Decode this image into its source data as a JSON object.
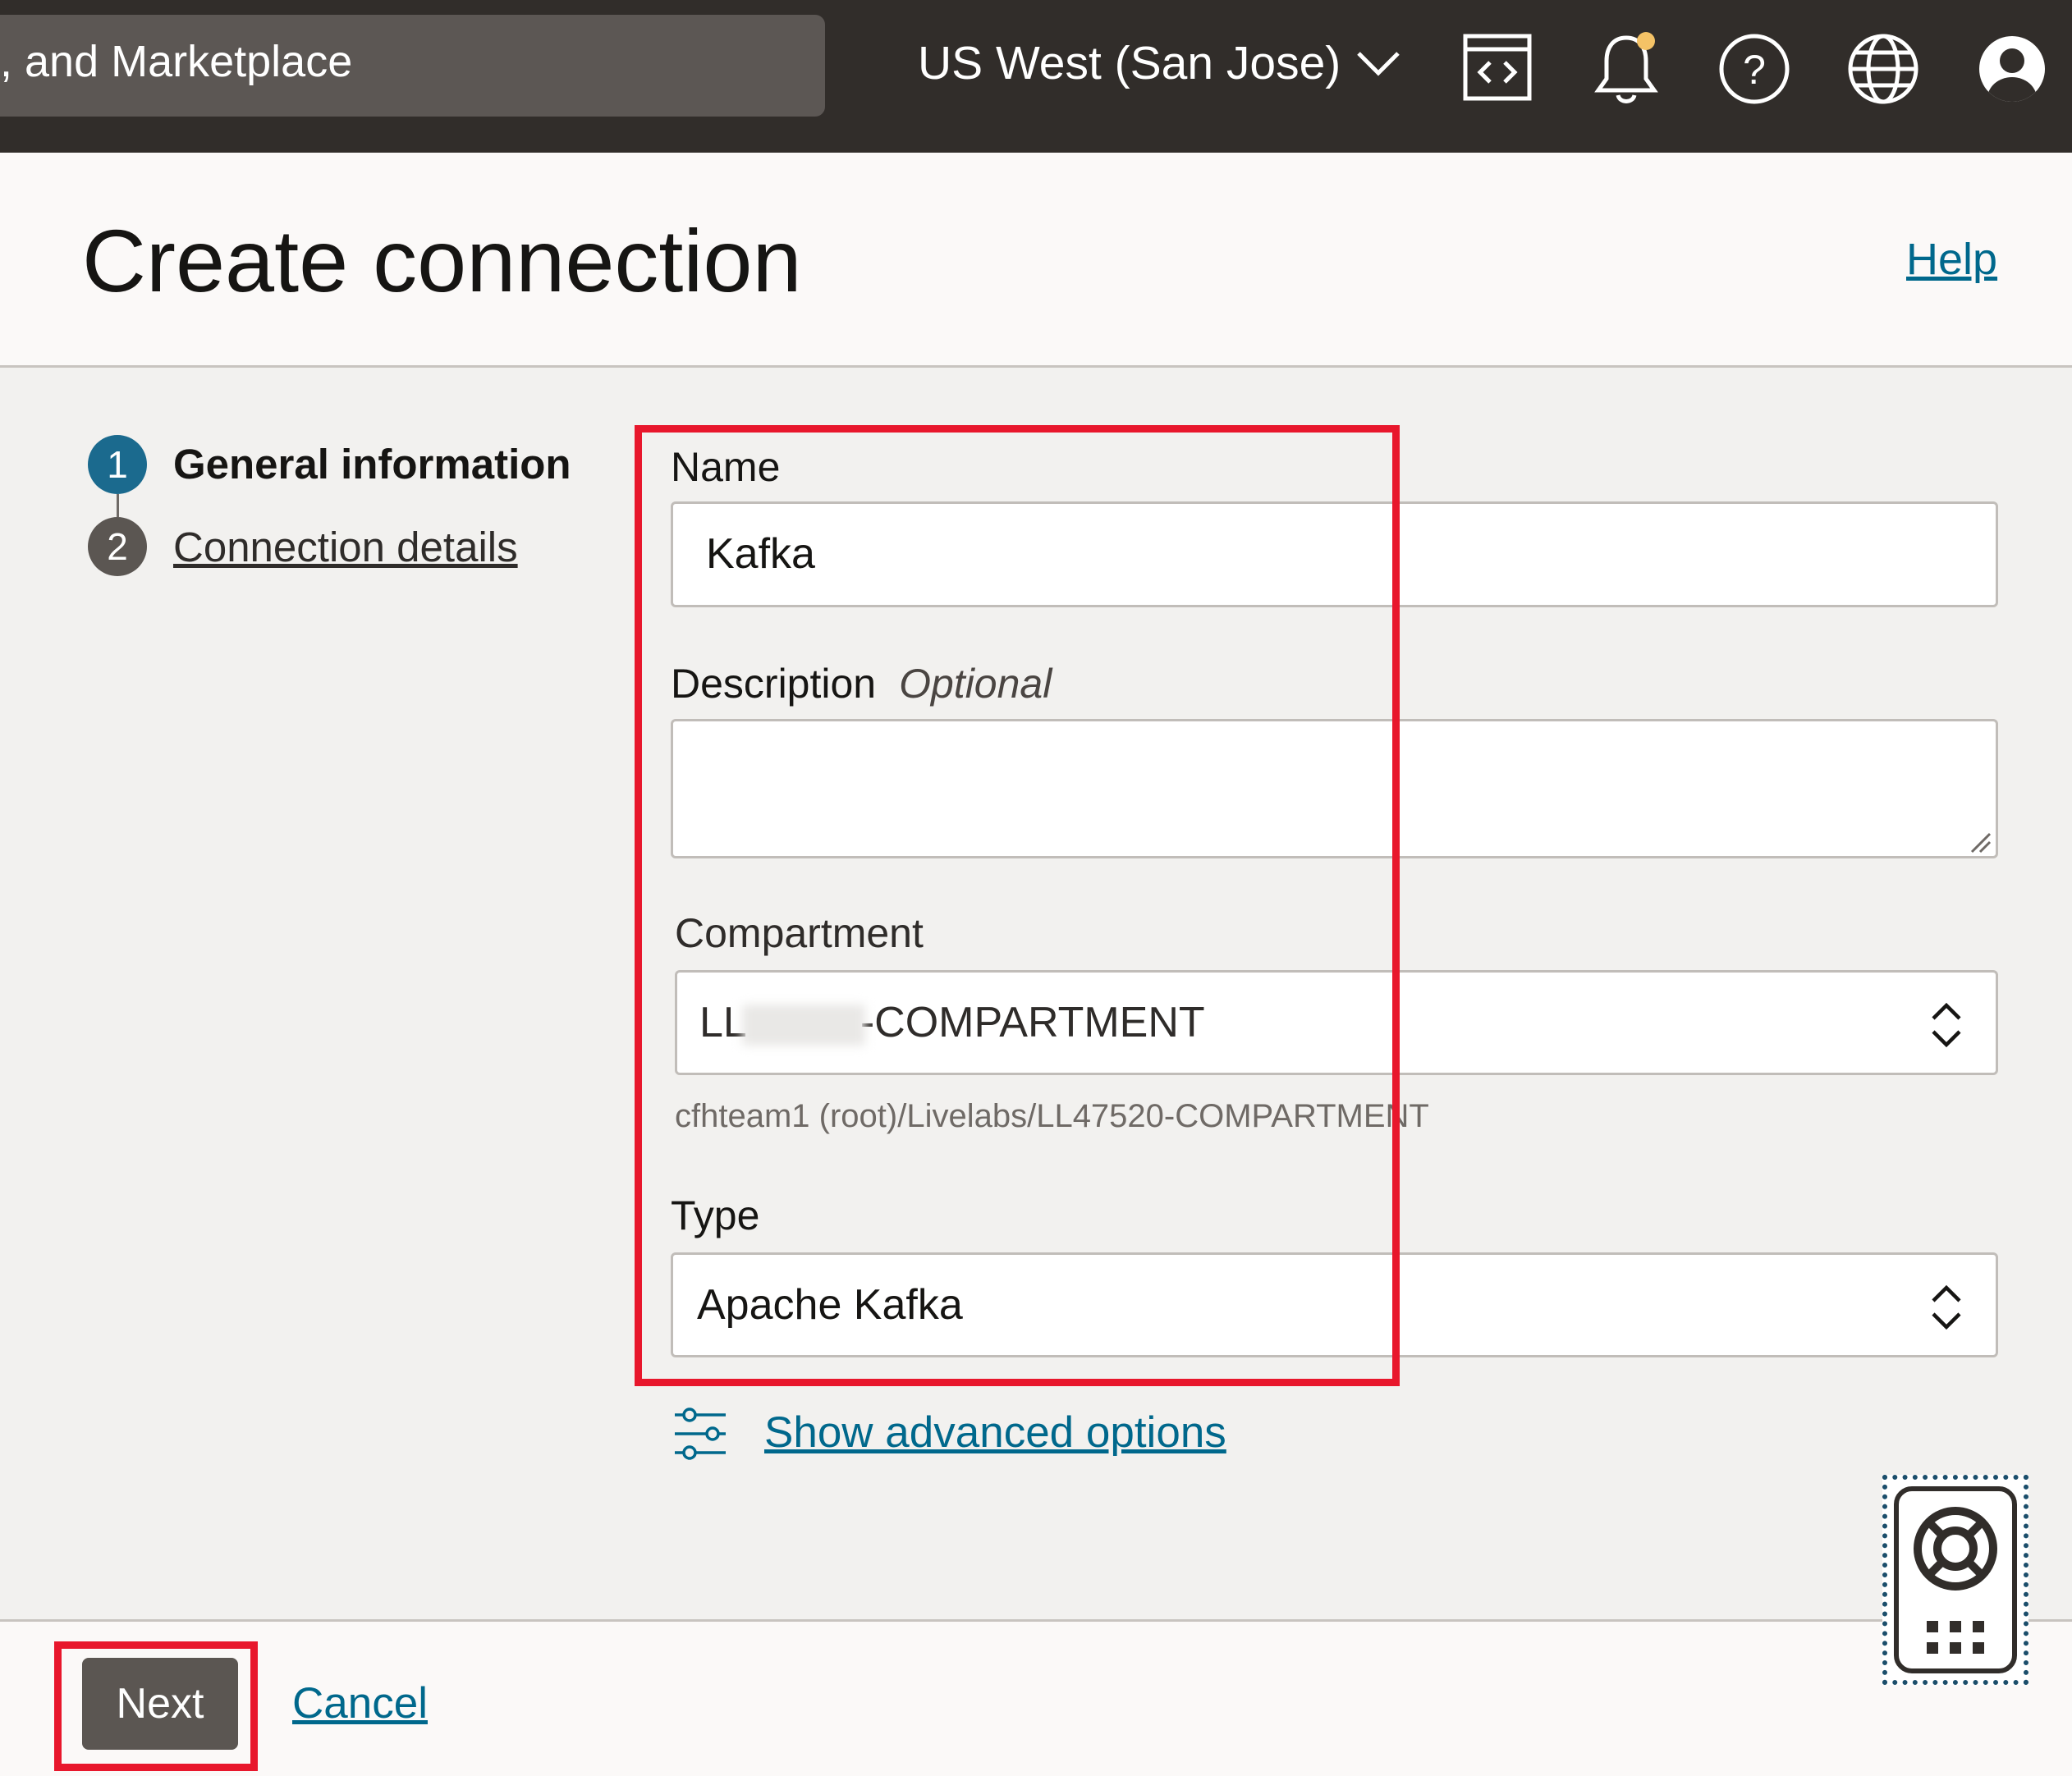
{
  "topbar": {
    "search_text": ", and Marketplace",
    "region": "US West (San Jose)",
    "icons": [
      "code-editor-icon",
      "bell-icon",
      "help-circle-icon",
      "globe-icon",
      "user-avatar-icon"
    ],
    "notification_dot_color": "#f4c266"
  },
  "header": {
    "title": "Create connection",
    "help_label": "Help"
  },
  "steps": [
    {
      "number": "1",
      "label": "General information",
      "active": true
    },
    {
      "number": "2",
      "label": "Connection details",
      "active": false
    }
  ],
  "form": {
    "name_label": "Name",
    "name_value": "Kafka",
    "description_label": "Description",
    "description_optional": "Optional",
    "description_value": "",
    "compartment_label": "Compartment",
    "compartment_value_prefix": "LL",
    "compartment_value_suffix": "-COMPARTMENT",
    "compartment_path": "cfhteam1 (root)/Livelabs/LL47520-COMPARTMENT",
    "type_label": "Type",
    "type_value": "Apache Kafka",
    "advanced_options_label": "Show advanced options"
  },
  "footer": {
    "next_label": "Next",
    "cancel_label": "Cancel"
  },
  "colors": {
    "topbar_bg": "#312d2a",
    "accent_step": "#1b6a8e",
    "link": "#00688c",
    "highlight": "#e8172c"
  }
}
